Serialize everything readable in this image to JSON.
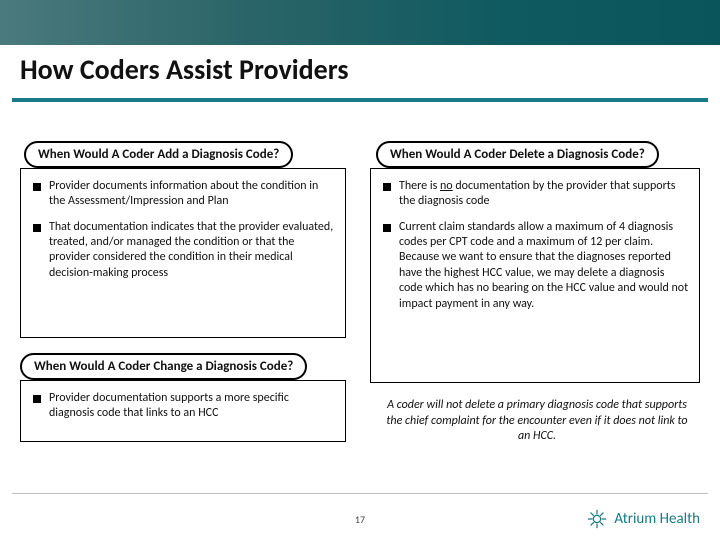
{
  "slide": {
    "title": "How Coders Assist Providers",
    "page_number": "17"
  },
  "sections": {
    "add": {
      "heading": "When Would A Coder Add a Diagnosis Code?",
      "bullets": [
        "Provider documents information about the condition in the Assessment/Impression and Plan",
        "That documentation indicates that the provider evaluated, treated, and/or managed the condition or that the provider considered the condition in their medical decision-making process"
      ]
    },
    "change": {
      "heading": "When Would A Coder Change a Diagnosis Code?",
      "bullets": [
        "Provider documentation supports a more specific diagnosis code that links to an HCC"
      ]
    },
    "delete": {
      "heading": "When Would A Coder Delete a Diagnosis Code?",
      "bullets_pre": "There is ",
      "bullets_underline": "no",
      "bullets_post": " documentation by the provider that supports the diagnosis code",
      "bullet2": "Current claim standards allow a maximum of 4 diagnosis codes per CPT code and a maximum of 12 per claim.  Because we want to ensure that the diagnoses reported have the highest HCC value, we may delete a diagnosis code which has no bearing on the HCC value and would not impact payment in any way."
    },
    "note": "A coder will not delete a primary diagnosis code that supports the chief complaint for the encounter even if it does not link to an HCC."
  },
  "brand": {
    "name": "Atrium Health",
    "icon_color": "#187a84"
  }
}
